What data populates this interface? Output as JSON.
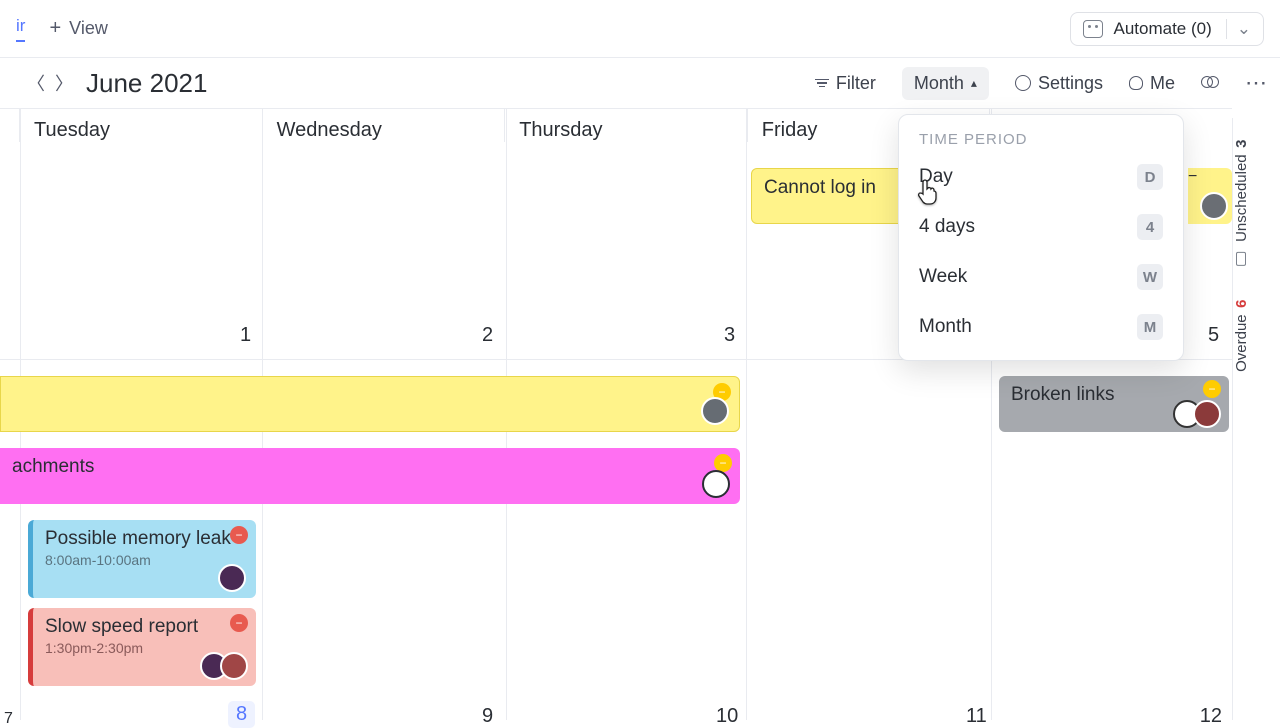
{
  "topbar": {
    "view_name": "ir",
    "add_view": "View",
    "automate": "Automate (0)"
  },
  "toolbar": {
    "title": "June 2021",
    "filter": "Filter",
    "month": "Month",
    "settings": "Settings",
    "me": "Me"
  },
  "days": {
    "tue": "Tuesday",
    "wed": "Wednesday",
    "thu": "Thursday",
    "fri": "Friday"
  },
  "dates_row1": {
    "c0": "",
    "c1": "1",
    "c2": "2",
    "c3": "3",
    "c5": "5"
  },
  "dates_row2": {
    "c0": "7",
    "c1": "8",
    "c2": "9",
    "c3": "10",
    "c4": "11",
    "c5": "12"
  },
  "events": {
    "login": "Cannot log in",
    "attachments": "achments",
    "broken": "Broken links",
    "memory": {
      "title": "Possible memory leak",
      "time": "8:00am-10:00am"
    },
    "slow": {
      "title": "Slow speed report",
      "time": "1:30pm-2:30pm"
    }
  },
  "dropdown": {
    "header": "TIME PERIOD",
    "day": "Day",
    "day_k": "D",
    "four": "4 days",
    "four_k": "4",
    "week": "Week",
    "week_k": "W",
    "month": "Month",
    "month_k": "M"
  },
  "right": {
    "unscheduled": "Unscheduled",
    "un_count": "3",
    "overdue": "Overdue",
    "ov_count": "6"
  }
}
